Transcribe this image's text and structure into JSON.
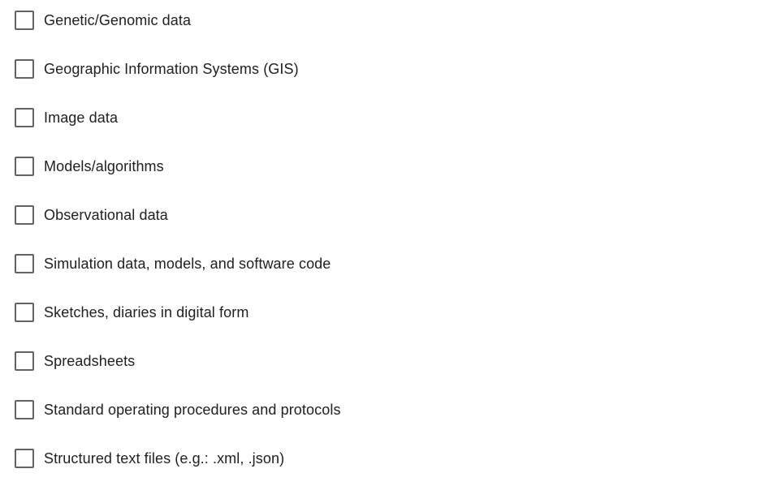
{
  "options": [
    {
      "label": "Genetic/Genomic data",
      "checked": false
    },
    {
      "label": "Geographic Information Systems (GIS)",
      "checked": false
    },
    {
      "label": "Image data",
      "checked": false
    },
    {
      "label": "Models/algorithms",
      "checked": false
    },
    {
      "label": "Observational data",
      "checked": false
    },
    {
      "label": "Simulation data, models, and software code",
      "checked": false
    },
    {
      "label": "Sketches, diaries in digital form",
      "checked": false
    },
    {
      "label": "Spreadsheets",
      "checked": false
    },
    {
      "label": "Standard operating procedures and protocols",
      "checked": false
    },
    {
      "label": "Structured text files (e.g.: .xml, .json)",
      "checked": false
    }
  ],
  "colors": {
    "checkbox_border": "#5f6368",
    "label_text": "#202124",
    "background": "#ffffff"
  }
}
